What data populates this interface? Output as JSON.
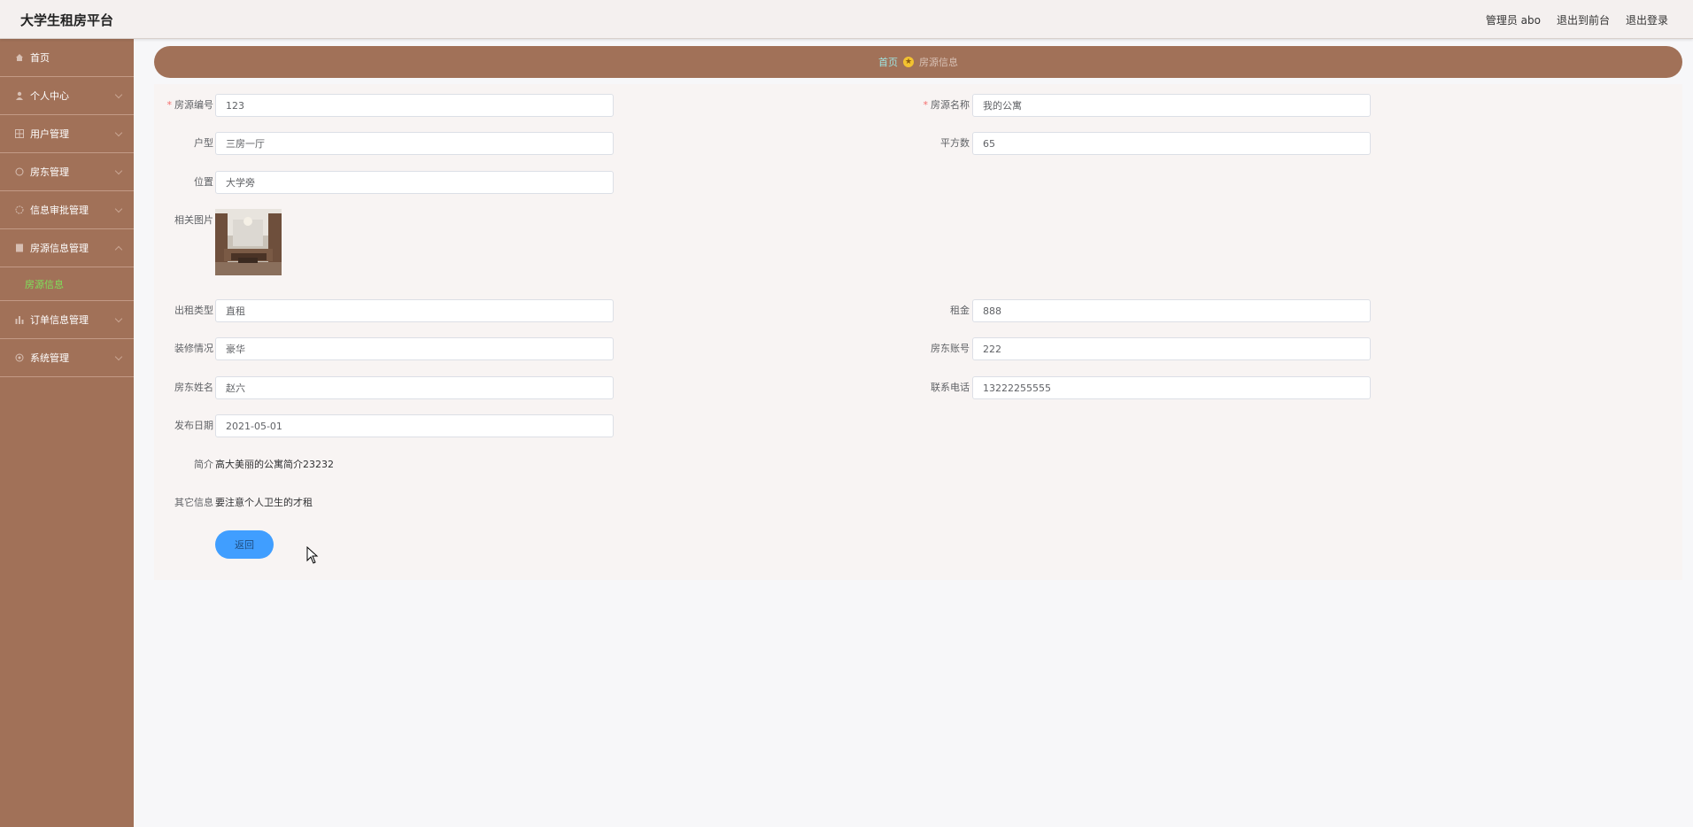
{
  "header": {
    "app_title": "大学生租房平台",
    "user_label": "管理员 abo",
    "to_front": "退出到前台",
    "logout": "退出登录"
  },
  "sidebar": {
    "items": [
      {
        "label": "首页",
        "icon": "home-icon"
      },
      {
        "label": "个人中心",
        "icon": "user-icon"
      },
      {
        "label": "用户管理",
        "icon": "grid-icon"
      },
      {
        "label": "房东管理",
        "icon": "circle-icon"
      },
      {
        "label": "信息审批管理",
        "icon": "clock-icon"
      },
      {
        "label": "房源信息管理",
        "icon": "doc-icon"
      },
      {
        "label": "订单信息管理",
        "icon": "bar-chart-icon"
      },
      {
        "label": "系统管理",
        "icon": "settings-icon"
      }
    ],
    "active_sub": "房源信息"
  },
  "breadcrumb": {
    "home": "首页",
    "current": "房源信息"
  },
  "form": {
    "house_no": {
      "label": "房源编号",
      "value": "123"
    },
    "house_name": {
      "label": "房源名称",
      "value": "我的公寓"
    },
    "layout": {
      "label": "户型",
      "value": "三房一厅"
    },
    "area": {
      "label": "平方数",
      "value": "65"
    },
    "location": {
      "label": "位置",
      "value": "大学旁"
    },
    "photo": {
      "label": "相关图片"
    },
    "rent_type": {
      "label": "出租类型",
      "value": "直租"
    },
    "rent": {
      "label": "租金",
      "value": "888"
    },
    "decoration": {
      "label": "装修情况",
      "value": "豪华"
    },
    "landlord_account": {
      "label": "房东账号",
      "value": "222"
    },
    "landlord_name": {
      "label": "房东姓名",
      "value": "赵六"
    },
    "contact_phone": {
      "label": "联系电话",
      "value": "13222255555"
    },
    "publish_date": {
      "label": "发布日期",
      "value": "2021-05-01"
    },
    "intro": {
      "label": "简介",
      "value": "高大美丽的公寓简介23232"
    },
    "other_info": {
      "label": "其它信息",
      "value": "要注意个人卫生的才租"
    },
    "back_button": "返回"
  },
  "colors": {
    "sidebar": "#a17158",
    "accent": "#409eff",
    "active_sub": "#7fe05a",
    "required": "#f56c6c"
  }
}
